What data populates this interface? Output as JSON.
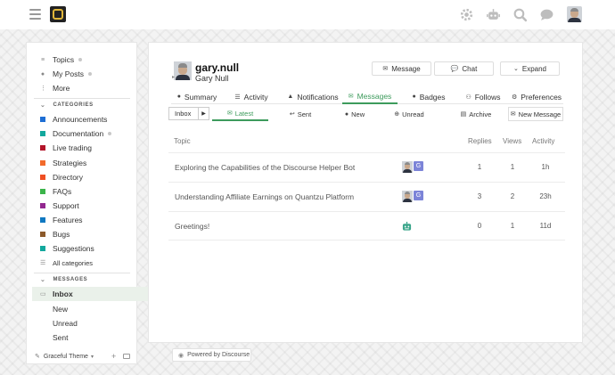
{
  "header": {
    "icons": [
      "hamburger-menu-icon",
      "site-logo",
      "theme-icon",
      "robot-icon",
      "search-icon",
      "chat-icon",
      "user-avatar"
    ]
  },
  "sidebar": {
    "top_items": [
      {
        "label": "Topics",
        "icon": "topics-icon"
      },
      {
        "label": "My Posts",
        "icon": "user-icon"
      },
      {
        "label": "More",
        "icon": "more-icon"
      }
    ],
    "categories_header": "CATEGORIES",
    "categories": [
      {
        "label": "Announcements",
        "color": "#1e6ed4"
      },
      {
        "label": "Documentation",
        "color": "#12a89d"
      },
      {
        "label": "Live trading",
        "color": "#b3152a"
      },
      {
        "label": "Strategies",
        "color": "#f26a2b"
      },
      {
        "label": "Directory",
        "color": "#ef4f22"
      },
      {
        "label": "FAQs",
        "color": "#3bb44a"
      },
      {
        "label": "Support",
        "color": "#92278f"
      },
      {
        "label": "Features",
        "color": "#0f78c1"
      },
      {
        "label": "Bugs",
        "color": "#8c5a2b"
      },
      {
        "label": "Suggestions",
        "color": "#12a89d"
      }
    ],
    "all_categories": "All categories",
    "messages_header": "MESSAGES",
    "messages": [
      {
        "label": "Inbox"
      },
      {
        "label": "New"
      },
      {
        "label": "Unread"
      },
      {
        "label": "Sent"
      }
    ],
    "footer_theme": "Graceful Theme"
  },
  "profile": {
    "username": "gary.null",
    "full_name": "Gary Null",
    "buttons": {
      "message": "Message",
      "chat": "Chat",
      "expand": "Expand"
    }
  },
  "tabs": [
    "Summary",
    "Activity",
    "Notifications",
    "Messages",
    "Badges",
    "Follows",
    "Preferences"
  ],
  "subnav": {
    "inbox_select": "Inbox",
    "items": [
      "Latest",
      "Sent",
      "New",
      "Unread",
      "Archive",
      "New Message"
    ]
  },
  "table": {
    "columns": [
      "Topic",
      "Replies",
      "Views",
      "Activity"
    ],
    "rows": [
      {
        "title": "Exploring the Capabilities of the Discourse Helper Bot",
        "poster_letter": "G",
        "replies": "1",
        "views": "1",
        "activity": "1h"
      },
      {
        "title": "Understanding Affiliate Earnings on Quantzu Platform",
        "poster_letter": "G",
        "replies": "3",
        "views": "2",
        "activity": "23h"
      },
      {
        "title": "Greetings!",
        "replies": "0",
        "views": "1",
        "activity": "11d"
      }
    ]
  },
  "footer": {
    "powered_by": "Powered by Discourse"
  },
  "colors": {
    "accent_green": "#3d9b5c",
    "logo_gold": "#e0b63a",
    "bot_green": "#3aa58a",
    "g_avatar": "#7c84d8"
  }
}
